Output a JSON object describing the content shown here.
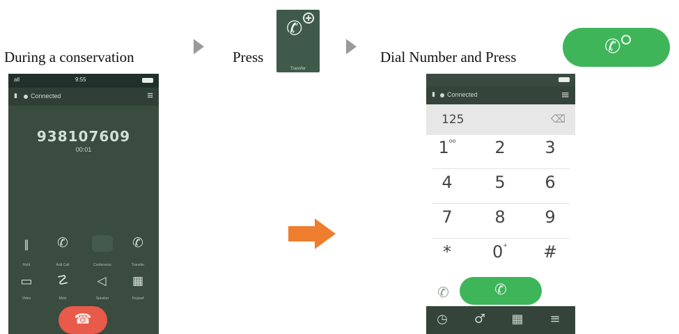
{
  "captions": {
    "step1": "During a conservation",
    "step2": "Press",
    "step3": "Dial Number and Press"
  },
  "icons": {
    "transfer_label": "Transfer",
    "transfer_glyph": "✆"
  },
  "phone1": {
    "carrier": "all",
    "time": "9:55",
    "status": "Connected",
    "number": "938107609",
    "duration": "00:01",
    "top_buttons": [
      "Hold",
      "Add Call",
      "Conference",
      "Transfer"
    ],
    "bottom_buttons": [
      "Video",
      "Mute",
      "Speaker",
      "Keypad"
    ],
    "glyphs": {
      "hold": "‖",
      "addcall": "✆",
      "transfer": "✆",
      "video": "▭",
      "mute": "☡",
      "speaker": "◁",
      "keypad": "▦",
      "hangup": "☎",
      "menu": "≡"
    }
  },
  "phone2": {
    "status": "Connected",
    "dialed": "125",
    "keys": [
      {
        "d": "1",
        "s": "oo"
      },
      {
        "d": "2",
        "s": ""
      },
      {
        "d": "3",
        "s": ""
      },
      {
        "d": "4",
        "s": ""
      },
      {
        "d": "5",
        "s": ""
      },
      {
        "d": "6",
        "s": ""
      },
      {
        "d": "7",
        "s": ""
      },
      {
        "d": "8",
        "s": ""
      },
      {
        "d": "9",
        "s": ""
      },
      {
        "d": "*",
        "s": ""
      },
      {
        "d": "0",
        "s": "+"
      },
      {
        "d": "#",
        "s": ""
      }
    ],
    "glyphs": {
      "backspace": "⌫",
      "recall": "✆",
      "transfer": "✆",
      "history": "◷",
      "contacts": "♂",
      "keypad": "▦",
      "menu": "≡"
    }
  },
  "colors": {
    "green": "#3fb55a",
    "orange": "#ef7d2e",
    "phone_dark": "#3a4b40",
    "hangup": "#e85a49"
  }
}
